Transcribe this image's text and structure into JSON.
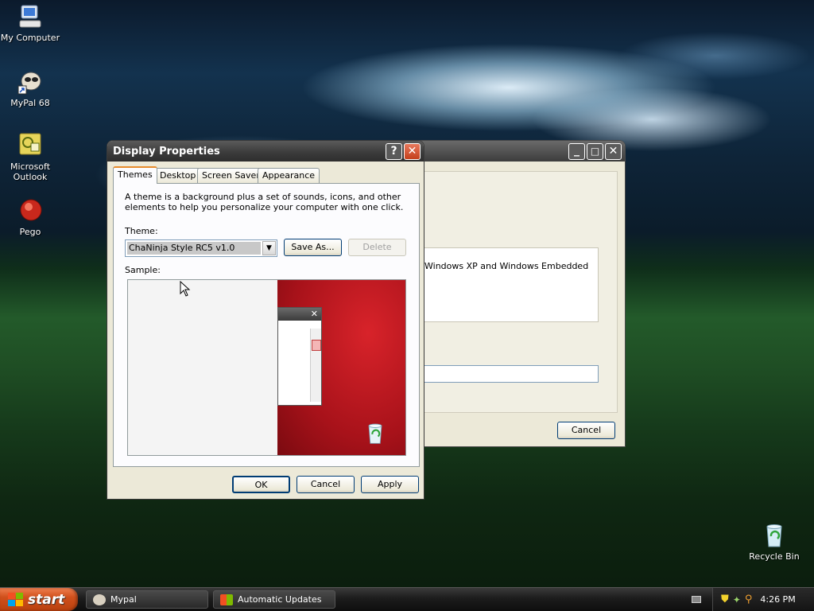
{
  "desktop": {
    "icons": [
      {
        "label": "My Computer",
        "icon": "computer-icon"
      },
      {
        "label": "MyPal 68",
        "icon": "mypal-icon"
      },
      {
        "label": "Microsoft Outlook",
        "icon": "outlook-icon"
      },
      {
        "label": "Pego",
        "icon": "pego-icon"
      },
      {
        "label": "Recycle Bin",
        "icon": "recycle-bin-icon"
      }
    ]
  },
  "bg_window": {
    "text": "Windows XP and Windows Embedded",
    "cancel_label": "Cancel"
  },
  "dialog": {
    "title": "Display Properties",
    "tabs": [
      "Themes",
      "Desktop",
      "Screen Saver",
      "Appearance"
    ],
    "active_tab": "Themes",
    "description": "A theme is a background plus a set of sounds, icons, and other elements to help you personalize your computer with one click.",
    "theme_label": "Theme:",
    "theme_value": "ChaNinja Style RC5 v1.0",
    "save_as_label": "Save As...",
    "delete_label": "Delete",
    "sample_label": "Sample:",
    "ok_label": "OK",
    "cancel_label": "Cancel",
    "apply_label": "Apply",
    "accent": "#d04a2c"
  },
  "taskbar": {
    "start_label": "start",
    "items": [
      {
        "label": "Mypal",
        "icon": "mypal-icon"
      },
      {
        "label": "Automatic Updates",
        "icon": "windows-update-icon"
      }
    ],
    "clock": "4:26 PM"
  }
}
